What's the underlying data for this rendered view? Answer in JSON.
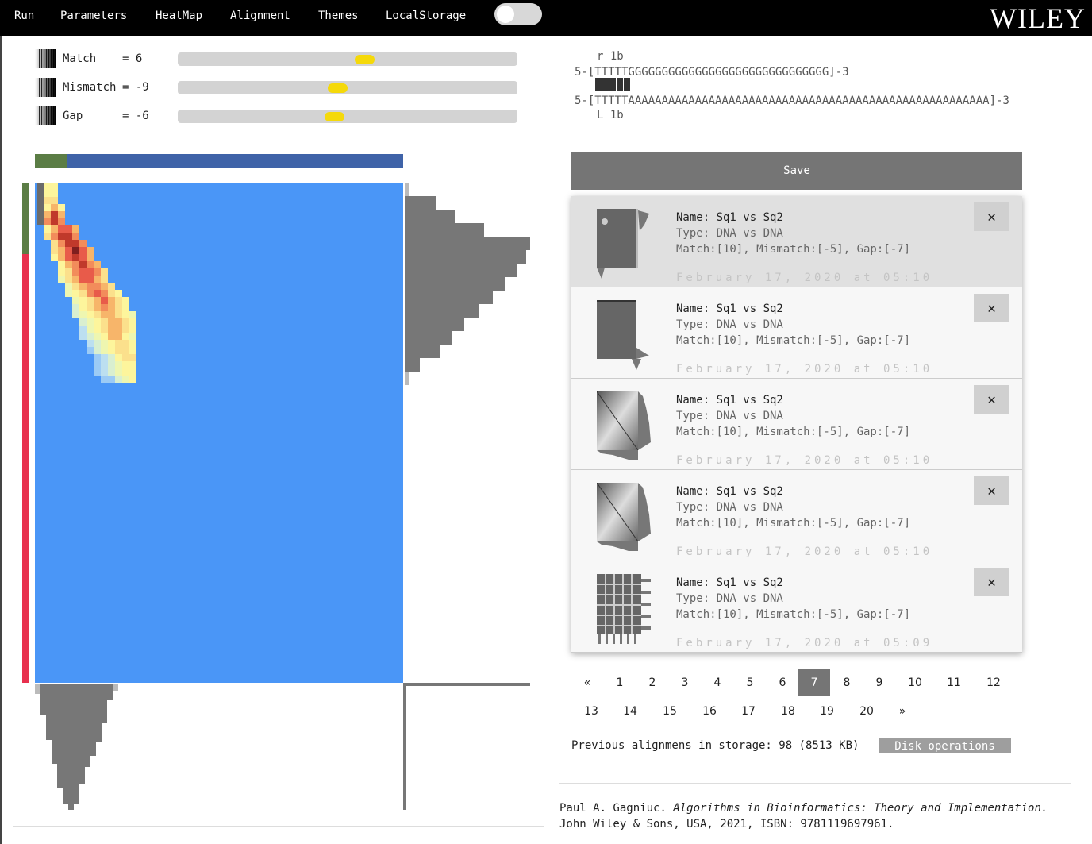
{
  "menu": {
    "items": [
      {
        "label": "Run",
        "name": "menu-run"
      },
      {
        "label": "Parameters",
        "name": "menu-parameters"
      },
      {
        "label": "HeatMap",
        "name": "menu-heatmap"
      },
      {
        "label": "Alignment",
        "name": "menu-alignment"
      },
      {
        "label": "Themes",
        "name": "menu-themes"
      },
      {
        "label": "LocalStorage",
        "name": "menu-localstorage"
      }
    ],
    "toggle_state": "off",
    "logo": "WILEY"
  },
  "parameters": [
    {
      "name": "Match",
      "value_text": "= 6",
      "slider_fraction": 0.55
    },
    {
      "name": "Mismatch",
      "value_text": "= -9",
      "slider_fraction": 0.47
    },
    {
      "name": "Gap",
      "value_text": "= -6",
      "slider_fraction": 0.46
    }
  ],
  "distribution_fraction": 0.086,
  "colors": {
    "topbar": "#000000",
    "heatmap_bg": "#4a96f7",
    "match_green": "#5b7d45",
    "mismatch_red": "#e8304e",
    "dist_blue": "#3f63a8",
    "slider_thumb": "#f5d90a",
    "histogram": "#777777",
    "button": "#757575"
  },
  "alignment": {
    "top_marker": "r 1b",
    "seq1": "5-[TTTTTGGGGGGGGGGGGGGGGGGGGGGGGGGGGGG]-3",
    "seq2": "5-[TTTTTAAAAAAAAAAAAAAAAAAAAAAAAAAAAAAAAAAAAAAAAAAAAAAAAAAAAAA]-3",
    "bottom_marker": "L 1b"
  },
  "save_label": "Save",
  "saved": [
    {
      "name": "Name: Sq1 vs Sq2",
      "type": "Type: DNA vs DNA",
      "params": "Match:[10], Mismatch:[-5], Gap:[-7]",
      "date": "February 17, 2020 at 05:10",
      "thumb": "solid-corner"
    },
    {
      "name": "Name: Sq1 vs Sq2",
      "type": "Type: DNA vs DNA",
      "params": "Match:[10], Mismatch:[-5], Gap:[-7]",
      "date": "February 17, 2020 at 05:10",
      "thumb": "solid"
    },
    {
      "name": "Name: Sq1 vs Sq2",
      "type": "Type: DNA vs DNA",
      "params": "Match:[10], Mismatch:[-5], Gap:[-7]",
      "date": "February 17, 2020 at 05:10",
      "thumb": "gradient"
    },
    {
      "name": "Name: Sq1 vs Sq2",
      "type": "Type: DNA vs DNA",
      "params": "Match:[10], Mismatch:[-5], Gap:[-7]",
      "date": "February 17, 2020 at 05:10",
      "thumb": "gradient"
    },
    {
      "name": "Name: Sq1 vs Sq2",
      "type": "Type: DNA vs DNA",
      "params": "Match:[10], Mismatch:[-5], Gap:[-7]",
      "date": "February 17, 2020 at 05:09",
      "thumb": "grid"
    }
  ],
  "delete_label": "✕",
  "pagination": {
    "prev": "«",
    "next": "»",
    "pages": [
      "1",
      "2",
      "3",
      "4",
      "5",
      "6",
      "7",
      "8",
      "9",
      "10",
      "11",
      "12",
      "13",
      "14",
      "15",
      "16",
      "17",
      "18",
      "19",
      "20"
    ],
    "active": "7"
  },
  "storage": {
    "text": "Previous alignmens in storage: 98 (8513 KB)",
    "disk_button": "Disk operations"
  },
  "citation": {
    "author": "Paul A. Gagniuc.",
    "title": "Algorithms in Bioinformatics: Theory and Implementation.",
    "rest": "John Wiley & Sons, USA, 2021, ISBN: 9781119697961."
  }
}
